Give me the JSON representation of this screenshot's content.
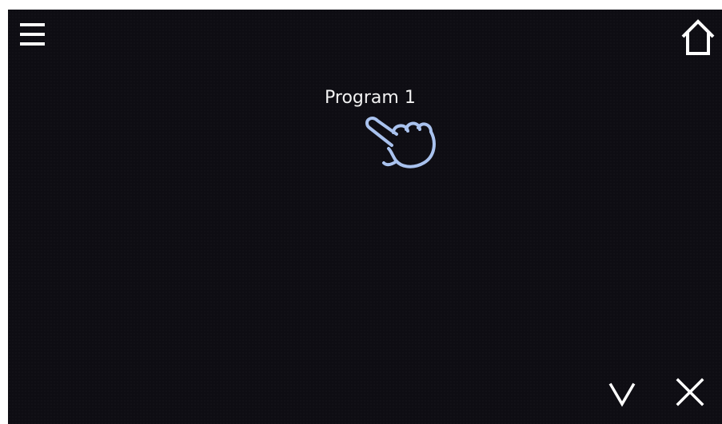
{
  "icons": {
    "menu": "hamburger-menu-icon",
    "home": "home-icon",
    "pointer": "pointing-hand-icon",
    "confirm": "chevron-down-icon",
    "cancel": "close-icon"
  },
  "colors": {
    "background": "#0e0d13",
    "foreground": "#ffffff",
    "hand_outline": "#a9c2ee"
  },
  "program_list": {
    "items": [
      {
        "label": "Program 1"
      }
    ]
  }
}
